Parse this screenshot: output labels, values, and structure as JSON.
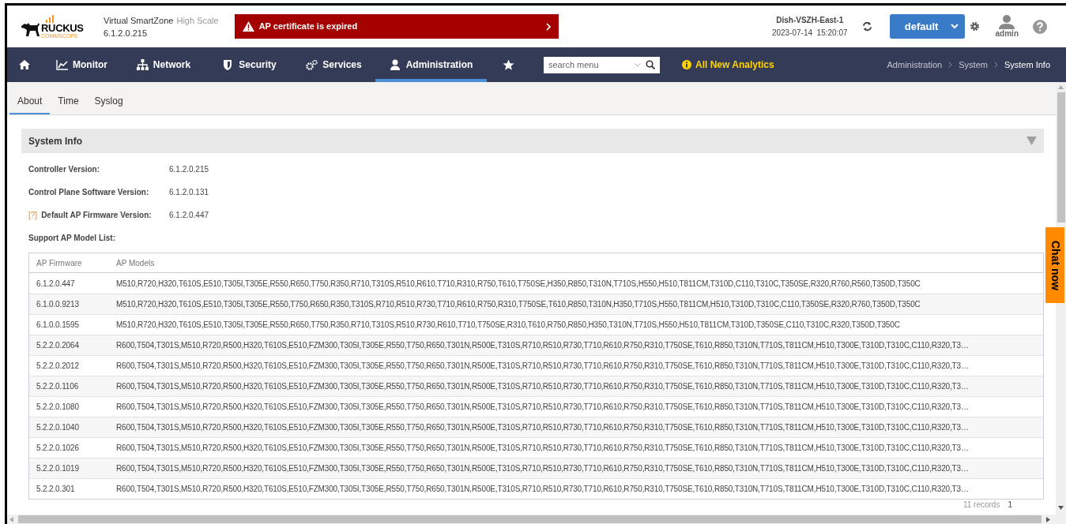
{
  "header": {
    "logo": {
      "brand": "RUCKUS",
      "sub": "COMMSCOPE"
    },
    "product": "Virtual SmartZone",
    "edition": "High Scale",
    "version": "6.1.2.0.215",
    "alert": "AP certificate is expired",
    "cluster": "Dish-VSZH-East-1",
    "datetime": "2023-07-14  15:20:07",
    "domain": "default",
    "user": "admin"
  },
  "nav": {
    "items": [
      {
        "selected": false
      },
      {
        "label": "Monitor",
        "selected": false
      },
      {
        "label": "Network",
        "selected": false
      },
      {
        "label": "Security",
        "selected": false
      },
      {
        "label": "Services",
        "selected": false
      },
      {
        "label": "Administration",
        "selected": true
      },
      {
        "selected": false
      }
    ],
    "search": {
      "placeholder": "search menu"
    },
    "analytics": "All New Analytics",
    "breadcrumb": [
      "Administration",
      "System",
      "System Info"
    ]
  },
  "tabs": [
    {
      "label": "About",
      "selected": true
    },
    {
      "label": "Time",
      "selected": false
    },
    {
      "label": "Syslog",
      "selected": false
    }
  ],
  "panel": {
    "title": "System Info",
    "fields": [
      {
        "label": "Controller Version:",
        "value": "6.1.2.0.215"
      },
      {
        "label": "Control Plane Software Version:",
        "value": "6.1.2.0.131"
      },
      {
        "label": "Default AP Firmware Version:",
        "value": "6.1.2.0.447",
        "help": "[?]"
      }
    ],
    "list_label": "Support AP Model List:",
    "table": {
      "columns": [
        "AP Firmware",
        "AP Models"
      ],
      "rows": [
        [
          "6.1.2.0.447",
          "M510,R720,H320,T610S,E510,T305I,T305E,R550,R650,T750,R350,R710,T310S,R510,R610,T710,R310,R750,T610,T750SE,H350,R850,T310N,T710S,H550,H510,T811CM,T310D,C110,T310C,T350SE,R320,R760,R560,T350D,T350C"
        ],
        [
          "6.1.0.0.9213",
          "M510,R720,H320,T610S,E510,T305I,T305E,R550,T750,R650,R350,T310S,R710,R510,R730,T710,R610,R750,R310,T750SE,T610,R850,T310N,H350,T710S,H550,T811CM,H510,T310D,T310C,C110,T350SE,R320,R760,T350D,T350C"
        ],
        [
          "6.1.0.0.1595",
          "M510,R720,H320,T610S,E510,T305I,T305E,R550,R650,T750,R350,R710,T310S,R510,R730,R610,T710,T750SE,R310,T610,R750,R850,H350,T310N,T710S,H550,H510,T811CM,T310D,T350SE,C110,T310C,R320,T350D,T350C"
        ],
        [
          "5.2.2.0.2064",
          "R600,T504,T301S,M510,R720,R500,H320,T610S,E510,FZM300,T305I,T305E,R550,T750,R650,T301N,R500E,T310S,R710,R510,R730,T710,R610,R750,R310,T750SE,T610,R850,T310N,T710S,T811CM,H510,T300E,T310D,T310C,C110,R320,T3…"
        ],
        [
          "5.2.2.0.2012",
          "R600,T504,T301S,M510,R720,R500,H320,T610S,E510,FZM300,T305I,T305E,R550,T750,R650,T301N,R500E,T310S,R710,R510,R730,T710,R610,R750,R310,T750SE,T610,R850,T310N,T710S,T811CM,H510,T300E,T310D,T310C,C110,R320,T3…"
        ],
        [
          "5.2.2.0.1106",
          "R600,T504,T301S,M510,R720,R500,H320,T610S,E510,FZM300,T305I,T305E,R550,T750,R650,T301N,R500E,T310S,R710,R510,R730,T710,R610,R750,R310,T750SE,T610,R850,T310N,T710S,T811CM,H510,T300E,T310D,T310C,C110,R320,T3…"
        ],
        [
          "5.2.2.0.1080",
          "R600,T504,T301S,M510,R720,R500,H320,T610S,E510,FZM300,T305I,T305E,R550,T750,R650,T301N,R500E,T310S,R710,R510,R730,T710,R610,R750,R310,T750SE,T610,R850,T310N,T710S,T811CM,H510,T300E,T310D,T310C,C110,R320,T3…"
        ],
        [
          "5.2.2.0.1040",
          "R600,T504,T301S,M510,R720,R500,H320,T610S,E510,FZM300,T305I,T305E,R550,T750,R650,T301N,R500E,T310S,R710,R510,R730,T710,R610,R750,R310,T750SE,T610,R850,T310N,T710S,T811CM,H510,T300E,T310D,T310C,C110,R320,T3…"
        ],
        [
          "5.2.2.0.1026",
          "R600,T504,T301S,M510,R720,R500,H320,T610S,E510,FZM300,T305I,T305E,R550,T750,R650,T301N,R500E,T310S,R710,R510,R730,T710,R610,R750,R310,T750SE,T610,R850,T310N,T710S,T811CM,H510,T300E,T310D,T310C,C110,R320,T3…"
        ],
        [
          "5.2.2.0.1019",
          "R600,T504,T301S,M510,R720,R500,H320,T610S,E510,FZM300,T305I,T305E,R550,T750,R650,T301N,R500E,T310S,R710,R510,R730,T710,R610,R750,R310,T750SE,T610,R850,T310N,T710S,T811CM,H510,T300E,T310D,T310C,C110,R320,T3…"
        ],
        [
          "5.2.2.0.301",
          "R600,T504,T301S,M510,R720,R500,H320,T610S,E510,FZM300,T305I,T305E,R550,T750,R650,T301N,R500E,T310S,R710,R510,R730,T710,R610,R750,R310,T750SE,T610,R850,T310N,T710S,T811CM,H510,T300E,T310D,T310C,C110,R320,T3…"
        ]
      ]
    },
    "records": "11 records",
    "page": "1"
  },
  "chat": "Chat now"
}
